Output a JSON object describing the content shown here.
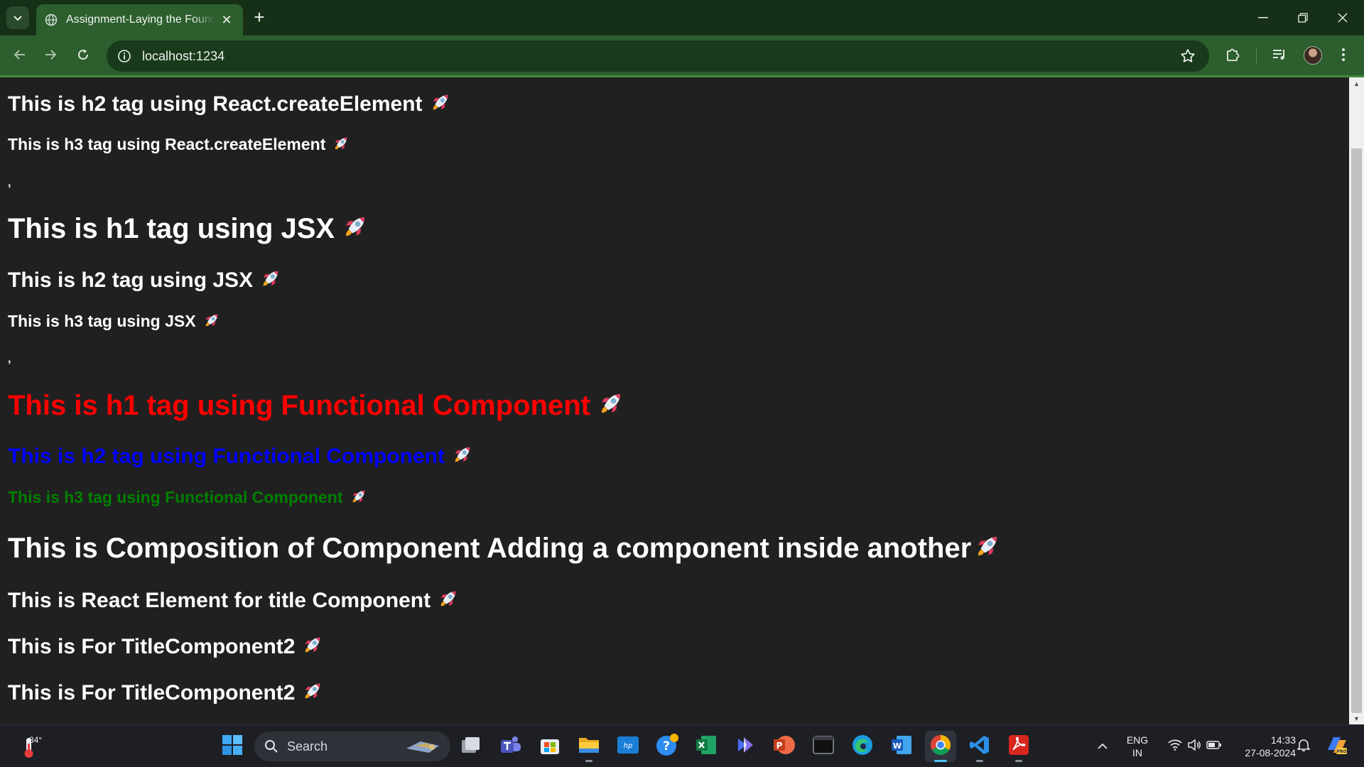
{
  "browser": {
    "tab_title": "Assignment-Laying the Foundation",
    "address": "localhost:1234"
  },
  "page": {
    "section_create_element": {
      "h2": "This is h2 tag using React.createElement",
      "h3": "This is h3 tag using React.createElement",
      "separator": ","
    },
    "section_jsx": {
      "h1": "This is h1 tag using JSX",
      "h2": "This is h2 tag using JSX",
      "h3": "This is h3 tag using JSX",
      "separator": ","
    },
    "section_functional": {
      "h1": "This is h1 tag using Functional Component",
      "h2": "This is h2 tag using Functional Component",
      "h3": "This is h3 tag using Functional Component"
    },
    "section_composition": {
      "h1": "This is Composition of Component Adding a component inside another",
      "h2_title": "This is React Element for title Component",
      "h2_component2_a": "This is For TitleComponent2",
      "h2_component2_b": "This is For TitleComponent2"
    },
    "emoji_icon": "rocket-icon",
    "colors": {
      "background": "#202020",
      "default_text": "#ffffff",
      "functional_h1": "#ff0000",
      "functional_h2": "#0000ff",
      "functional_h3": "#008000"
    }
  },
  "taskbar": {
    "weather_temp": "84°",
    "search_placeholder": "Search",
    "language_top": "ENG",
    "language_bottom": "IN",
    "time": "14:33",
    "date": "27-08-2024"
  }
}
